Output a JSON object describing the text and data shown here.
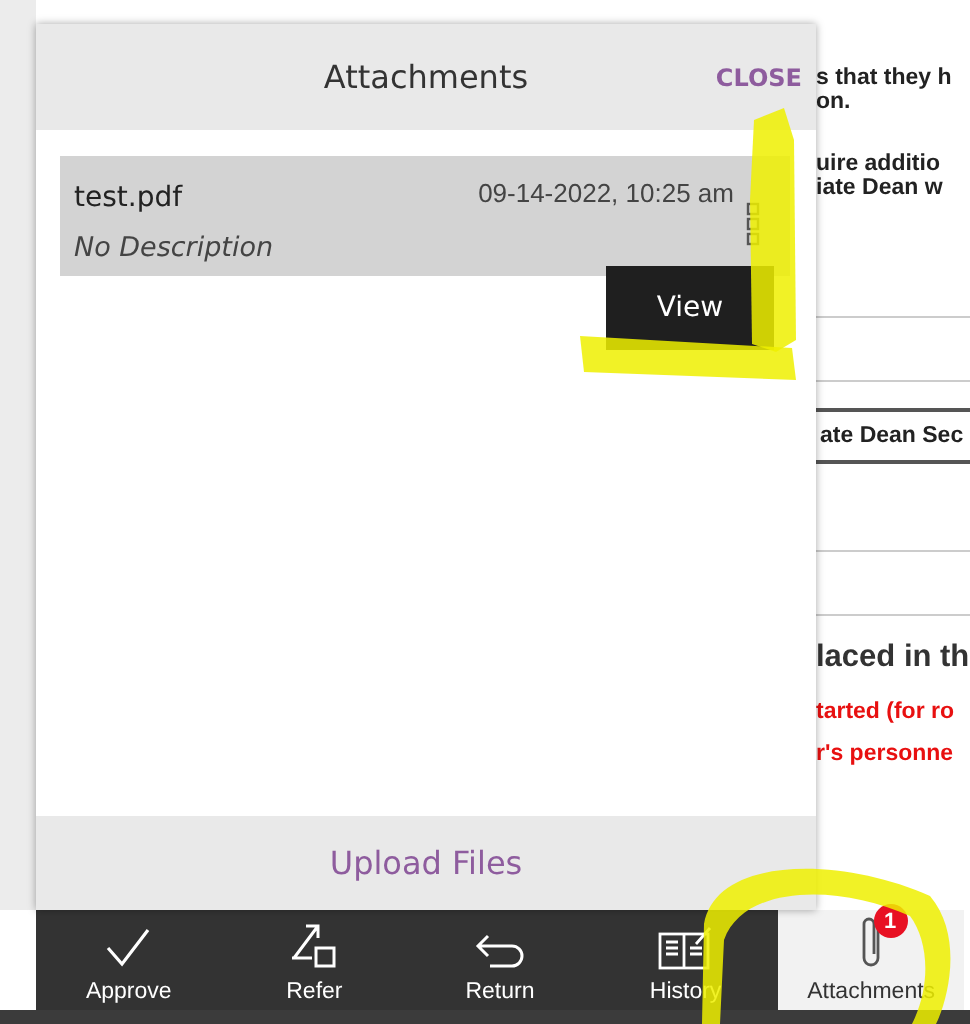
{
  "background": {
    "paragraphs": [
      [
        "s that they h",
        "on."
      ],
      [
        "uire additio",
        "iate Dean w"
      ]
    ],
    "table_header": "ate Dean Sec",
    "heading": "laced in th",
    "alerts": [
      "tarted (for ro",
      "r's personne"
    ]
  },
  "panel": {
    "title": "Attachments",
    "close": "CLOSE",
    "files": [
      {
        "name": "test.pdf",
        "date": "09-14-2022, 10:25 am",
        "description": "No Description",
        "menu": "View"
      }
    ],
    "upload": "Upload Files"
  },
  "toolbar": [
    {
      "label": "Approve",
      "kind": "check",
      "selected": false
    },
    {
      "label": "Refer",
      "kind": "refer",
      "selected": false
    },
    {
      "label": "Return",
      "kind": "return",
      "selected": false
    },
    {
      "label": "History",
      "kind": "book",
      "selected": false
    },
    {
      "label": "Attachments",
      "kind": "paperclip",
      "selected": true,
      "badge": "1"
    }
  ],
  "highlights": [
    {
      "kind": "bracket"
    },
    {
      "kind": "underline"
    },
    {
      "kind": "circle"
    }
  ]
}
